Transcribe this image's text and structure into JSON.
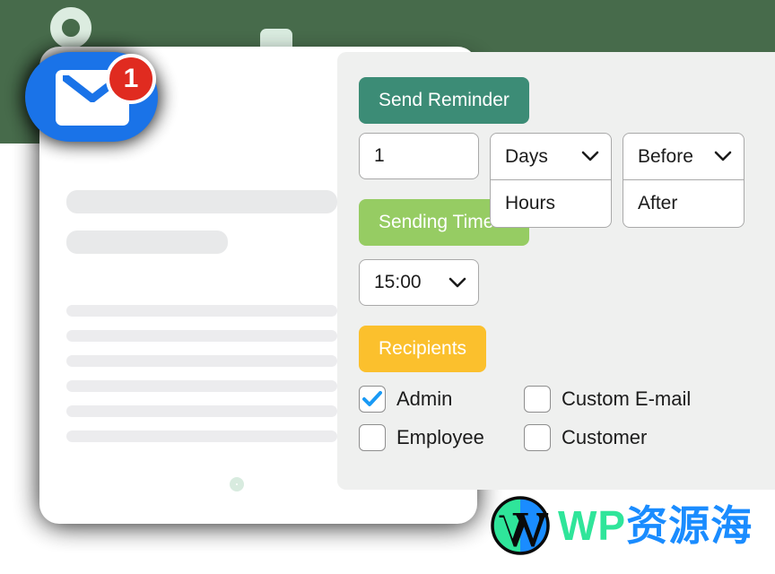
{
  "panel": {
    "send_reminder_label": "Send Reminder",
    "amount_value": "1",
    "unit_selected": "Days",
    "unit_option": "Hours",
    "when_selected": "Before",
    "when_option": "After",
    "sending_time_label": "Sending Time",
    "time_value": "15:00",
    "recipients_label": "Recipients"
  },
  "recipients": {
    "rows": [
      [
        {
          "label": "Admin",
          "checked": true
        },
        {
          "label": "Custom E-mail",
          "checked": false
        }
      ],
      [
        {
          "label": "Employee",
          "checked": false
        },
        {
          "label": "Customer",
          "checked": false
        }
      ]
    ]
  },
  "mail_icon": {
    "badge_count": "1"
  },
  "watermark": {
    "wp": "WP",
    "cn": "资源海"
  },
  "colors": {
    "backdrop_green": "#476b4b",
    "panel_bg": "#eff0ef",
    "send_reminder": "#3c8c76",
    "sending_time": "#96cc63",
    "recipients": "#fbc02d",
    "mail_blue": "#1a73e8",
    "badge_red": "#e02b20",
    "check_blue": "#1a9af5",
    "deco_green": "#d9ebdf",
    "wm_green": "#2fe59a",
    "wm_blue": "#1a8cff"
  }
}
